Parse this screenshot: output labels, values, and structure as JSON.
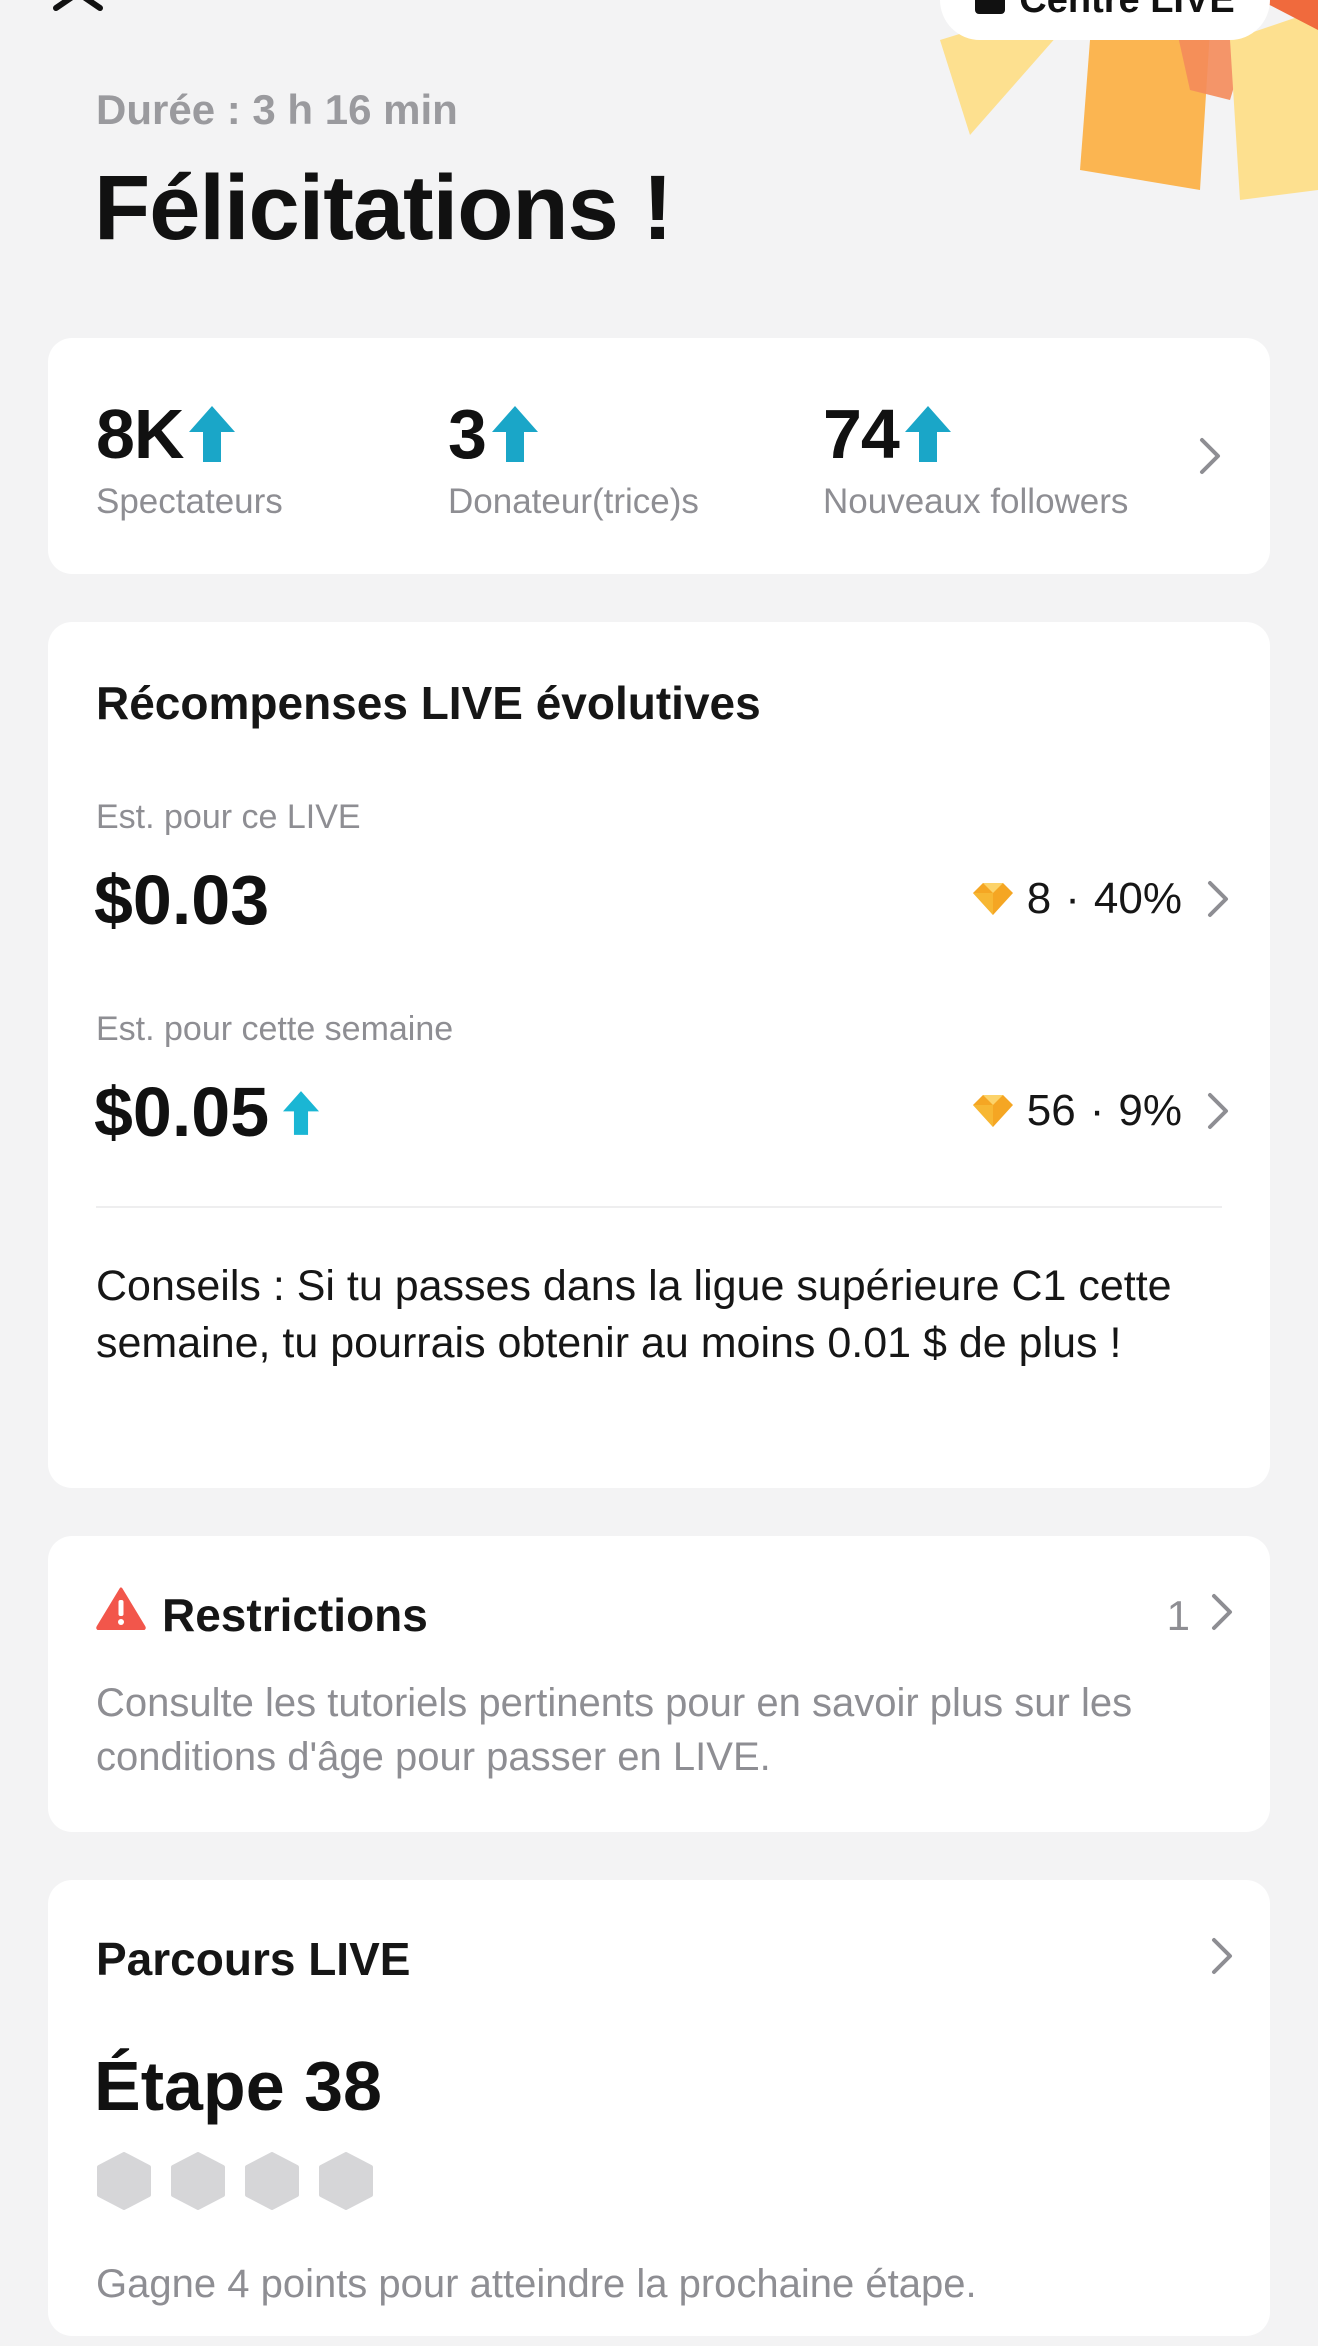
{
  "header": {
    "duration": "Durée : 3 h 16 min",
    "title": "Félicitations !",
    "live_center_label": "Centre LIVE"
  },
  "stats": [
    {
      "value": "8K",
      "label": "Spectateurs"
    },
    {
      "value": "3",
      "label": "Donateur(trice)s"
    },
    {
      "value": "74",
      "label": "Nouveaux followers"
    }
  ],
  "rewards": {
    "title": "Récompenses LIVE évolutives",
    "live": {
      "label": "Est. pour ce LIVE",
      "amount": "$0.03",
      "diamonds": "8",
      "percent": "40%"
    },
    "week": {
      "label": "Est. pour cette semaine",
      "amount": "$0.05",
      "diamonds": "56",
      "percent": "9%"
    },
    "separator": "·",
    "tips": "Conseils : Si tu passes dans la ligue supérieure C1 cette semaine, tu pourrais obtenir au moins 0.01 $ de plus !"
  },
  "restrictions": {
    "title": "Restrictions",
    "count": "1",
    "description": "Consulte les tutoriels pertinents pour en savoir plus sur les conditions d'âge pour passer en LIVE."
  },
  "journey": {
    "title": "Parcours LIVE",
    "step": "Étape 38",
    "points_filled": 0,
    "points_total": 4,
    "description": "Gagne 4 points pour atteindre la prochaine étape."
  },
  "colors": {
    "accent_arrow": "#1aa6c8",
    "warning": "#f2564b",
    "diamond": "#f5a623",
    "background": "#f3f3f4"
  }
}
